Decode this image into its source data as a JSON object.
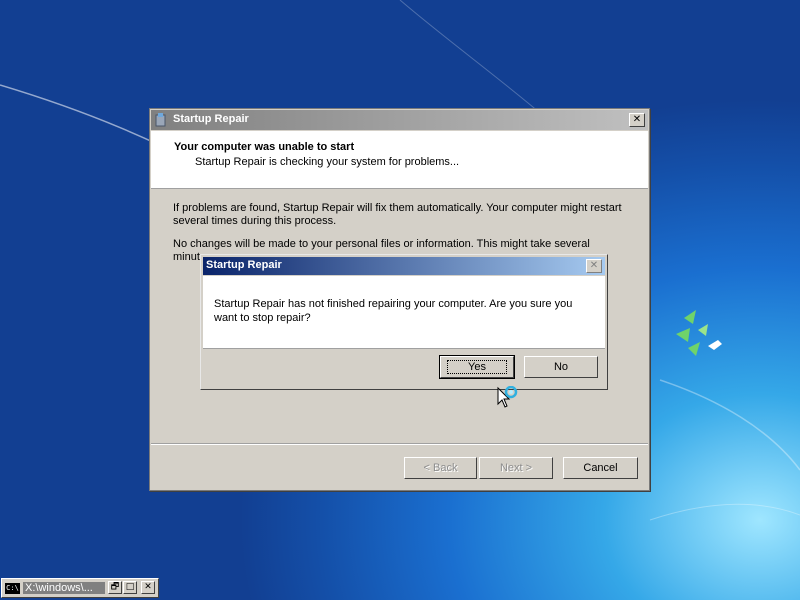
{
  "wizard": {
    "title": "Startup Repair",
    "close_glyph": "✕",
    "header_title": "Your computer was unable to start",
    "header_subtitle": "Startup Repair is checking your system for problems...",
    "paragraph1": "If problems are found, Startup Repair will fix them automatically. Your computer might restart several times during this process.",
    "paragraph2": "No changes will be made to your personal files or information. This might take several minutes.",
    "back_label": "< Back",
    "next_label": "Next >",
    "cancel_label": "Cancel"
  },
  "dialog": {
    "title": "Startup Repair",
    "close_glyph": "✕",
    "message": "Startup Repair has not finished repairing your computer. Are you sure you want to stop repair?",
    "yes_label": "Yes",
    "no_label": "No"
  },
  "taskbar": {
    "console_icon_text": "C:\\",
    "console_title": "X:\\windows\\...",
    "minimize_glyph": "🗗",
    "maximize_glyph": "□",
    "close_glyph": "✕"
  },
  "colors": {
    "desktop_blue": "#1a6fd0",
    "dialog_titlebar": "#0a246a",
    "wizard_titlebar_inactive": "#808080"
  }
}
